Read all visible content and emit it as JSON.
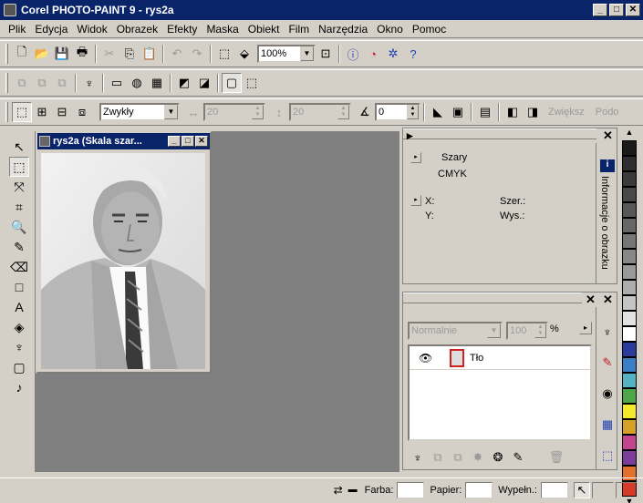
{
  "window": {
    "title": "Corel PHOTO-PAINT 9 - rys2a",
    "minimize": "_",
    "maximize": "□",
    "close": "✕"
  },
  "menu": [
    "Plik",
    "Edycja",
    "Widok",
    "Obrazek",
    "Efekty",
    "Maska",
    "Obiekt",
    "Film",
    "Narzędzia",
    "Okno",
    "Pomoc"
  ],
  "toolbar": {
    "zoom": "100%"
  },
  "property_bar": {
    "mode": "Zwykły",
    "width_value": "20",
    "height_value": "20",
    "angle_value": "0",
    "zwieksz": "Zwiększ",
    "podo": "Podo"
  },
  "document": {
    "title": "rys2a (Skala szar..."
  },
  "info_docker": {
    "color_mode_label": "Szary",
    "cmyk_label": "CMYK",
    "x_label": "X:",
    "y_label": "Y:",
    "width_label": "Szer.:",
    "height_label": "Wys.:",
    "tab_label": "Informacje o obrazku"
  },
  "objects_docker": {
    "merge_mode": "Normalnie",
    "opacity": "100",
    "opacity_unit": "%",
    "layer_name": "Tło"
  },
  "status": {
    "farba_label": "Farba:",
    "papier_label": "Papier:",
    "wypelnienie_label": "Wypełn.:"
  },
  "palette": [
    "#1a1a1a",
    "#2e2e2e",
    "#3a3a3a",
    "#484848",
    "#575757",
    "#666666",
    "#767676",
    "#878787",
    "#9a9a9a",
    "#adadad",
    "#c4c4c4",
    "#e2e2e2",
    "#ffffff",
    "#2b3b9c",
    "#3a7fc6",
    "#53b3c3",
    "#4fa54a",
    "#f3ea2b",
    "#d4a02a",
    "#c4458f",
    "#7b3d99",
    "#e1702d",
    "#d63b2a"
  ]
}
